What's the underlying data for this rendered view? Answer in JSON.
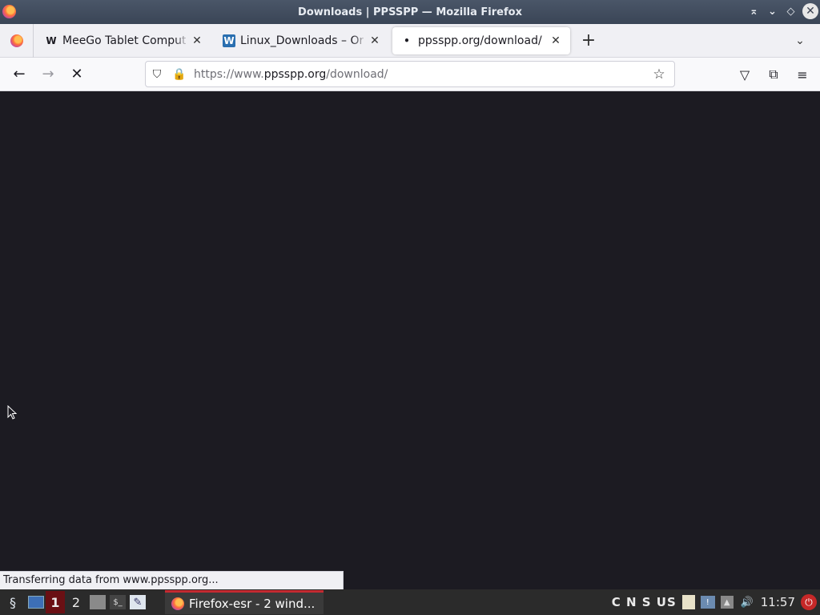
{
  "window": {
    "title": "Downloads | PPSSPP — Mozilla Firefox",
    "controls": {
      "minimize_icon": "⌅",
      "maximize_icon": "⌄",
      "restore_icon": "◇",
      "close_icon": "✕"
    }
  },
  "tabs": [
    {
      "favicon": "W",
      "label": "MeeGo Tablet Computex",
      "active": false
    },
    {
      "favicon": "W",
      "label": "Linux_Downloads – Orac",
      "active": false
    },
    {
      "favicon": "•",
      "label": "ppsspp.org/download/",
      "active": true
    }
  ],
  "tabstrip": {
    "new_tab_icon": "+",
    "list_tabs_icon": "⌄"
  },
  "navbar": {
    "back_icon": "←",
    "forward_icon": "→",
    "stop_icon": "✕",
    "url_prefix": "https://www.",
    "url_host": "ppsspp.org",
    "url_path": "/download/",
    "shield_icon": "⛉",
    "lock_icon": "🔒",
    "bookmark_icon": "☆",
    "pocket_icon": "▽",
    "extensions_icon": "⧉",
    "menu_icon": "≡"
  },
  "status": {
    "text": "Transferring data from www.ppsspp.org..."
  },
  "taskbar": {
    "start_icon": "§",
    "workspaces": [
      {
        "label": "1",
        "active": true
      },
      {
        "label": "2",
        "active": false
      }
    ],
    "task_label": "Firefox-esr - 2 wind...",
    "keyboard_locks": "C N S US",
    "clock": "11:57"
  }
}
